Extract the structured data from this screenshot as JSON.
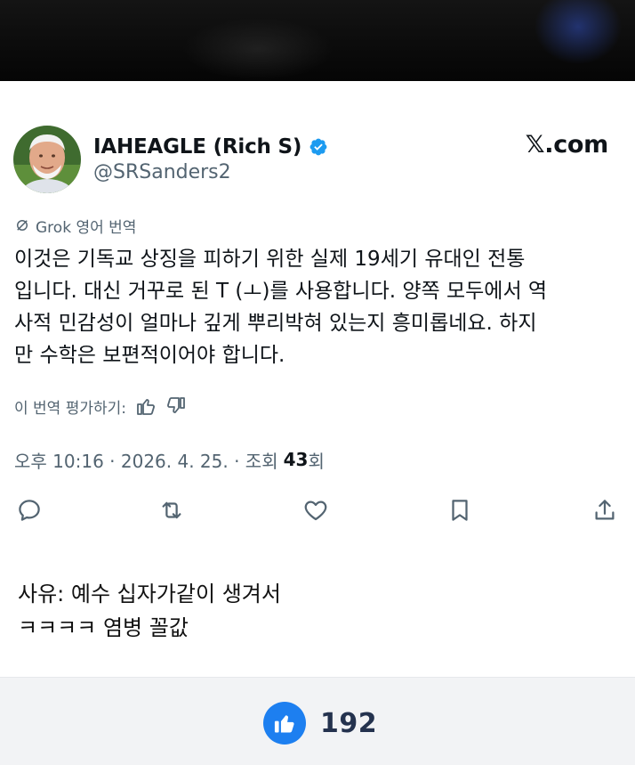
{
  "tweet": {
    "display_name": "IAHEAGLE (Rich S)",
    "handle": "@SRSanders2",
    "brand": "𝕏.com",
    "translation_label": "Grok 영어 번역",
    "text_lines": [
      "이것은 기독교 상징을 피하기 위한 실제 19세기 유대인 전통",
      "입니다. 대신 거꾸로 된 T (ㅗ)를 사용합니다. 양쪽 모두에서 역",
      "사적 민감성이 얼마나 깊게 뿌리박혀 있는지 흥미롭네요. 하지",
      "만 수학은 보편적이어야 합니다."
    ],
    "rate_label": "이 번역 평가하기:",
    "timestamp": "오후 10:16 · 2026. 4. 25. · 조회",
    "views": "43",
    "views_suffix": "회",
    "actions": [
      "reply-icon",
      "retweet-icon",
      "like-icon",
      "bookmark-icon",
      "share-icon"
    ]
  },
  "comment": {
    "lines": [
      "사유: 예수 십자가같이 생겨서",
      "ㅋㅋㅋㅋ 염병 꼴값"
    ]
  },
  "footer": {
    "like_count": "192"
  },
  "colors": {
    "verified": "#1d9bf0",
    "secondary_text": "#536471",
    "like_button": "#1d7ff0",
    "footer_bg": "#f2f3f5"
  }
}
